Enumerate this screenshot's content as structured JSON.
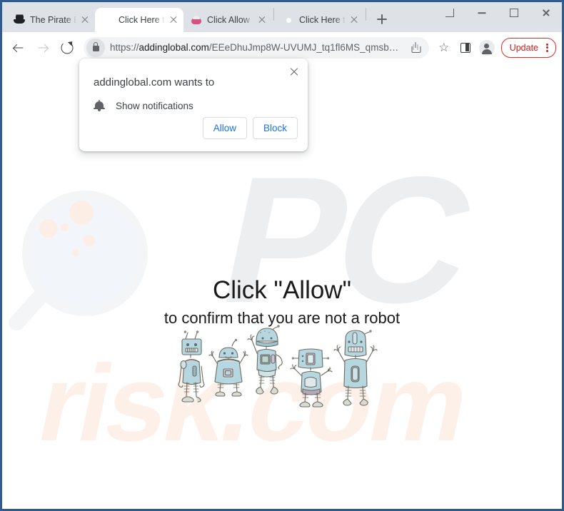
{
  "window": {
    "controls": [
      {
        "name": "tab-search",
        "glyph": "chevron-down"
      },
      {
        "name": "minimize",
        "glyph": "minus"
      },
      {
        "name": "maximize",
        "glyph": "square"
      },
      {
        "name": "close",
        "glyph": "x"
      }
    ]
  },
  "tabs": [
    {
      "title": "The Pirate B",
      "favicon": "pirate-ship-icon",
      "active": false
    },
    {
      "title": "Click Here t",
      "favicon": "chrome-icon",
      "active": true
    },
    {
      "title": "Click Allow",
      "favicon": "pink-character-icon",
      "active": false
    },
    {
      "title": "Click Here t",
      "favicon": "chrome-icon",
      "active": false
    }
  ],
  "newtab_label": "+",
  "toolbar": {
    "back_label": "Back",
    "forward_label": "Forward",
    "reload_label": "Reload",
    "url_scheme": "https://",
    "url_domain": "addinglobal.com",
    "url_path": "/EEeDhuJmp8W-UVUMJ_tq1fl6MS_qmsb…",
    "share_label": "Share",
    "bookmark_label": "Bookmark this tab",
    "side_panel_label": "Side panel",
    "profile_label": "Profile",
    "update_label": "Update",
    "menu_label": "Customize and control Google Chrome"
  },
  "dialog": {
    "title": "addinglobal.com wants to",
    "permission": "Show notifications",
    "allow_label": "Allow",
    "block_label": "Block",
    "close_label": "Close",
    "accent_color": "#1a73e8"
  },
  "page": {
    "headline": "Click \"Allow\"",
    "subheadline": "to confirm that you are not a robot",
    "illustration": "five-robots-illustration",
    "watermark_logo": "PC",
    "watermark_text": "risk.com",
    "watermark_glass": "magnifying-glass-icon",
    "watermark_gray": "#eceef0",
    "watermark_peach": "#fdf0e8"
  }
}
